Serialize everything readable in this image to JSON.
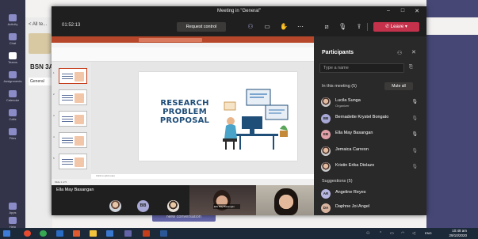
{
  "teams_bg": {
    "rail": [
      {
        "label": "Activity"
      },
      {
        "label": "Chat"
      },
      {
        "label": "Teams"
      },
      {
        "label": "Assignments"
      },
      {
        "label": "Calendar"
      },
      {
        "label": "Calls"
      },
      {
        "label": "Files"
      },
      {
        "label": "Apps"
      },
      {
        "label": "Help"
      }
    ],
    "all_teams": "< All te...",
    "team_name": "BSN 3A",
    "channel": "General",
    "new_conversation": "New conversation"
  },
  "meeting": {
    "title": "Meeting in \"General\"",
    "timer": "01:52:13",
    "request_control": "Request control",
    "leave": "Leave",
    "icons": {
      "participants": "people-icon",
      "chat": "chat-icon",
      "raise_hand": "hand-icon",
      "more": "more-icon",
      "camera": "camera-off-icon",
      "mic": "mic-icon",
      "share": "share-icon"
    },
    "presenter_name": "Ella May Basangan"
  },
  "slide": {
    "title_lines": [
      "RESEARCH",
      "PROBLEM",
      "PROPOSAL"
    ],
    "thumb_numbers": [
      "1",
      "2",
      "3",
      "4",
      "5"
    ],
    "notes_hint": "Click to add notes",
    "status_text": "Slide 1 of 5"
  },
  "video": {
    "bb_initials": "BB",
    "tile1_label": "Ella May Basangan"
  },
  "panel": {
    "title": "Participants",
    "search_placeholder": "Type a name",
    "in_meeting_label": "In this meeting (5)",
    "mute_all": "Mute all",
    "participants": [
      {
        "name": "Lucila Sunga",
        "role": "Organizer",
        "initials": "",
        "mic": "on"
      },
      {
        "name": "Bernadette Krystel Bongato",
        "role": "",
        "initials": "BB",
        "mic": "off"
      },
      {
        "name": "Ella May Basangan",
        "role": "",
        "initials": "EB",
        "mic": "on"
      },
      {
        "name": "Jemaica Carreon",
        "role": "",
        "initials": "",
        "mic": "off"
      },
      {
        "name": "Kristin Erika Diolazo",
        "role": "",
        "initials": "",
        "mic": "off"
      }
    ],
    "suggestions_label": "Suggestions (5)",
    "suggestions": [
      {
        "name": "Angeline Reyes",
        "initials": "AR"
      },
      {
        "name": "Daphne Joi Angel",
        "initials": "DA"
      }
    ]
  },
  "taskbar": {
    "lang": "ENG",
    "time": "10:48 am",
    "date": "29/10/2020"
  },
  "colors": {
    "teams_purple": "#6264a7",
    "leave_red": "#c4314b",
    "ppt_orange": "#b7472a",
    "slide_title": "#1f4e79"
  }
}
